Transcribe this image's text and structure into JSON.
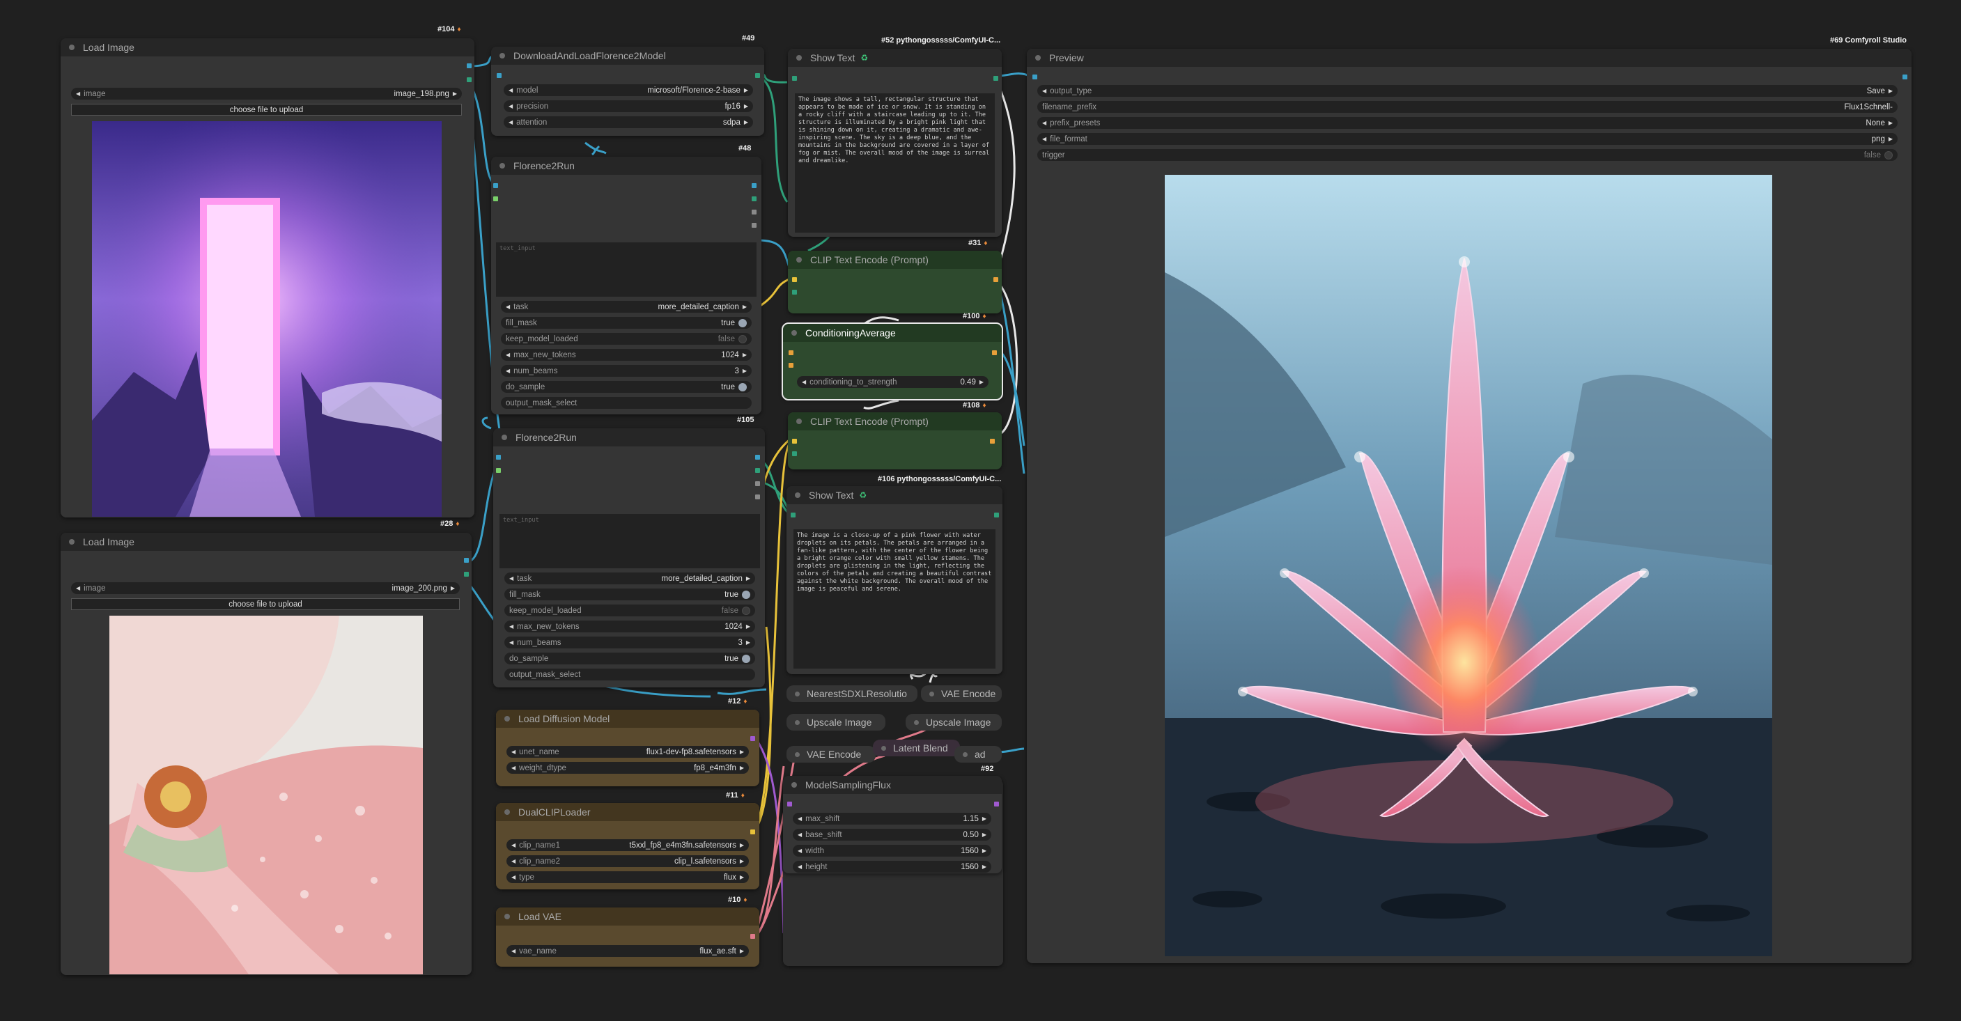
{
  "colors": {
    "canvas": "#202020",
    "node_body": "#353535",
    "node_header": "#262626",
    "clip_node": "#2e4a2e",
    "loader_node": "#5a4a2e",
    "wire_cyan": "#3aa0c8",
    "wire_yellow": "#e8c23a",
    "wire_pink": "#e07a8a",
    "wire_green": "#2fa07a",
    "wire_purple": "#a05ad0"
  },
  "nodes": {
    "load_image_1": {
      "badge": "#104",
      "title": "Load Image",
      "image_label": "image",
      "image_value": "image_198.png",
      "upload_label": "choose file to upload"
    },
    "load_image_2": {
      "badge": "#28",
      "title": "Load Image",
      "image_label": "image",
      "image_value": "image_200.png",
      "upload_label": "choose file to upload"
    },
    "download_florence": {
      "badge": "#49",
      "title": "DownloadAndLoadFlorence2Model",
      "widgets": [
        {
          "name": "model",
          "value": "microsoft/Florence-2-base"
        },
        {
          "name": "precision",
          "value": "fp16"
        },
        {
          "name": "attention",
          "value": "sdpa"
        }
      ]
    },
    "florence_run_1": {
      "badge": "#48",
      "title": "Florence2Run",
      "text_input_placeholder": "text_input",
      "task_label": "task",
      "task_value": "more_detailed_caption",
      "fill_mask_label": "fill_mask",
      "fill_mask_value": "true",
      "keep_label": "keep_model_loaded",
      "keep_value": "false",
      "max_tokens_label": "max_new_tokens",
      "max_tokens_value": "1024",
      "beams_label": "num_beams",
      "beams_value": "3",
      "sample_label": "do_sample",
      "sample_value": "true",
      "mask_select_label": "output_mask_select"
    },
    "florence_run_2": {
      "badge": "#105",
      "title": "Florence2Run",
      "text_input_placeholder": "text_input",
      "task_label": "task",
      "task_value": "more_detailed_caption",
      "fill_mask_label": "fill_mask",
      "fill_mask_value": "true",
      "keep_label": "keep_model_loaded",
      "keep_value": "false",
      "max_tokens_label": "max_new_tokens",
      "max_tokens_value": "1024",
      "beams_label": "num_beams",
      "beams_value": "3",
      "sample_label": "do_sample",
      "sample_value": "true",
      "mask_select_label": "output_mask_select"
    },
    "load_diffusion": {
      "badge": "#12",
      "title": "Load Diffusion Model",
      "unet_label": "unet_name",
      "unet_value": "flux1-dev-fp8.safetensors",
      "dtype_label": "weight_dtype",
      "dtype_value": "fp8_e4m3fn"
    },
    "dual_clip": {
      "badge": "#11",
      "title": "DualCLIPLoader",
      "clip1_label": "clip_name1",
      "clip1_value": "t5xxl_fp8_e4m3fn.safetensors",
      "clip2_label": "clip_name2",
      "clip2_value": "clip_l.safetensors",
      "type_label": "type",
      "type_value": "flux"
    },
    "load_vae": {
      "badge": "#10",
      "title": "Load VAE",
      "vae_label": "vae_name",
      "vae_value": "flux_ae.sft"
    },
    "show_text_1": {
      "badge": "#52 pythongosssss/ComfyUI-C...",
      "title": "Show Text",
      "text": "The image shows a tall, rectangular structure that appears to be made of ice or snow. It is standing on a rocky cliff with a staircase leading up to it. The structure is illuminated by a bright pink light that is shining down on it, creating a dramatic and awe-inspiring scene. The sky is a deep blue, and the mountains in the background are covered in a layer of fog or mist. The overall mood of the image is surreal and dreamlike."
    },
    "clip_encode_1": {
      "badge": "#31",
      "title": "CLIP Text Encode (Prompt)"
    },
    "cond_average": {
      "badge": "#100",
      "title": "ConditioningAverage",
      "strength_label": "conditioning_to_strength",
      "strength_value": "0.49"
    },
    "clip_encode_2": {
      "badge": "#108",
      "title": "CLIP Text Encode (Prompt)"
    },
    "show_text_2": {
      "badge": "#106 pythongosssss/ComfyUI-C...",
      "title": "Show Text",
      "text": "The image is a close-up of a pink flower with water droplets on its petals. The petals are arranged in a fan-like pattern, with the center of the flower being a bright orange color with small yellow stamens. The droplets are glistening in the light, reflecting the colors of the petals and creating a beautiful contrast against the white background. The overall mood of the image is peaceful and serene."
    },
    "minis": {
      "nearest": "NearestSDXLResolutio",
      "vae_encode_1": "VAE Encode",
      "upscale_1": "Upscale Image",
      "upscale_2": "Upscale Image",
      "vae_encode_2": "VAE Encode",
      "latent_blend": "Latent Blend",
      "ad": "ad",
      "latent_badge": "#92"
    },
    "model_sampling": {
      "title": "ModelSamplingFlux",
      "max_shift_label": "max_shift",
      "max_shift_value": "1.15",
      "base_shift_label": "base_shift",
      "base_shift_value": "0.50",
      "width_label": "width",
      "width_value": "1560",
      "height_label": "height",
      "height_value": "1560"
    },
    "preview": {
      "badge": "#69 Comfyroll Studio",
      "title": "Preview",
      "output_type_label": "output_type",
      "output_type_value": "Save",
      "prefix_label": "filename_prefix",
      "prefix_value": "Flux1Schnell-",
      "presets_label": "prefix_presets",
      "presets_value": "None",
      "format_label": "file_format",
      "format_value": "png",
      "trigger_label": "trigger",
      "trigger_value": "false"
    }
  }
}
